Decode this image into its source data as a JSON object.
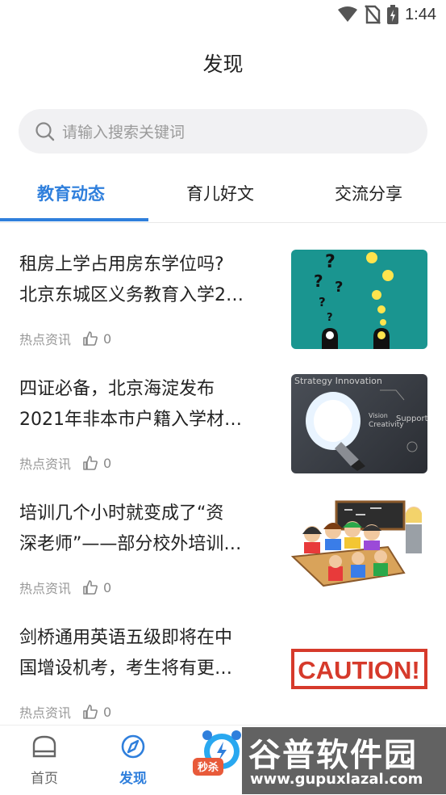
{
  "status_bar": {
    "time": "1:44"
  },
  "header": {
    "title": "发现"
  },
  "search": {
    "placeholder": "请输入搜索关键词"
  },
  "tabs": [
    {
      "label": "教育动态",
      "active": true
    },
    {
      "label": "育儿好文",
      "active": false
    },
    {
      "label": "交流分享",
      "active": false
    }
  ],
  "articles": [
    {
      "title_line1": "租房上学占用房东学位吗?",
      "title_line2": "北京东城区义务教育入学2…",
      "category": "热点资讯",
      "likes": "0"
    },
    {
      "title_line1": "四证必备，北京海淀发布",
      "title_line2": "2021年非本市户籍入学材…",
      "category": "热点资讯",
      "likes": "0"
    },
    {
      "title_line1": "培训几个小时就变成了“资",
      "title_line2": "深老师”——部分校外培训…",
      "category": "热点资讯",
      "likes": "0"
    },
    {
      "title_line1": "剑桥通用英语五级即将在中",
      "title_line2": "国增设机考，考生将有更…",
      "category": "热点资讯",
      "likes": "0"
    }
  ],
  "thumb_text": {
    "strategy": "Strategy Innovation",
    "vision": "Vision",
    "creativity": "Creativity",
    "support": "Support",
    "caution": "CAUTION!"
  },
  "bottom_nav": {
    "home": "首页",
    "discover": "发现",
    "promo_badge": "秒杀"
  },
  "watermark": {
    "brand": "谷普软件园",
    "url": "www.gupuxlazal.com"
  },
  "colors": {
    "accent": "#2f7fdc",
    "teal_thumb": "#1a9590",
    "caution_red": "#d63a2b"
  }
}
